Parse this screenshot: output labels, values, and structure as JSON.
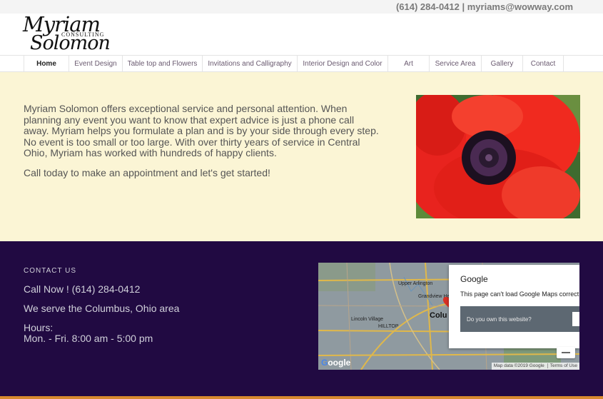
{
  "header": {
    "contact": "(614) 284-0412 | myriams@wowway.com"
  },
  "logo": {
    "line1": "Myriam",
    "line2": "CONSULTING",
    "line3": "Solomon"
  },
  "nav": {
    "items": [
      {
        "label": "Home",
        "active": true
      },
      {
        "label": "Event Design"
      },
      {
        "label": "Table top and Flowers"
      },
      {
        "label": "Invitations and Calligraphy"
      },
      {
        "label": "Interior Design and Color"
      },
      {
        "label": "Art"
      },
      {
        "label": "Service Area"
      },
      {
        "label": "Gallery"
      },
      {
        "label": "Contact"
      }
    ]
  },
  "hero": {
    "paragraph": "Myriam Solomon offers exceptional service and personal attention. When planning any event you want to know that expert advice is just a phone call away. Myriam helps you formulate a plan and is by your side through every step. No event is too small or too large. With over thirty years of service in Central Ohio, Myriam has worked with hundreds of happy clients.",
    "cta": "Call today to make an appointment and let's get started!"
  },
  "footer": {
    "heading": "CONTACT US",
    "call": "Call Now ! (614) 284-0412",
    "area": "We serve the Columbus, Ohio area",
    "hours_label": "Hours:",
    "hours": "Mon. - Fri. 8:00 am - 5:00 pm"
  },
  "map": {
    "dialog_title": "Google",
    "dialog_message": "This page can't load Google Maps correct",
    "dialog_question": "Do you own this website?",
    "attribution": "Map data ©2019 Google",
    "terms": "Terms of Use",
    "labels": {
      "upper_arlington": "Upper Arlington",
      "grandview": "Grandview Heights",
      "lincoln_village": "Lincoln Village",
      "hilltop": "HILLTOP",
      "columbus": "Colu"
    },
    "colors": {
      "roads": "#e0b84a",
      "background": "#8f9aa0"
    }
  }
}
